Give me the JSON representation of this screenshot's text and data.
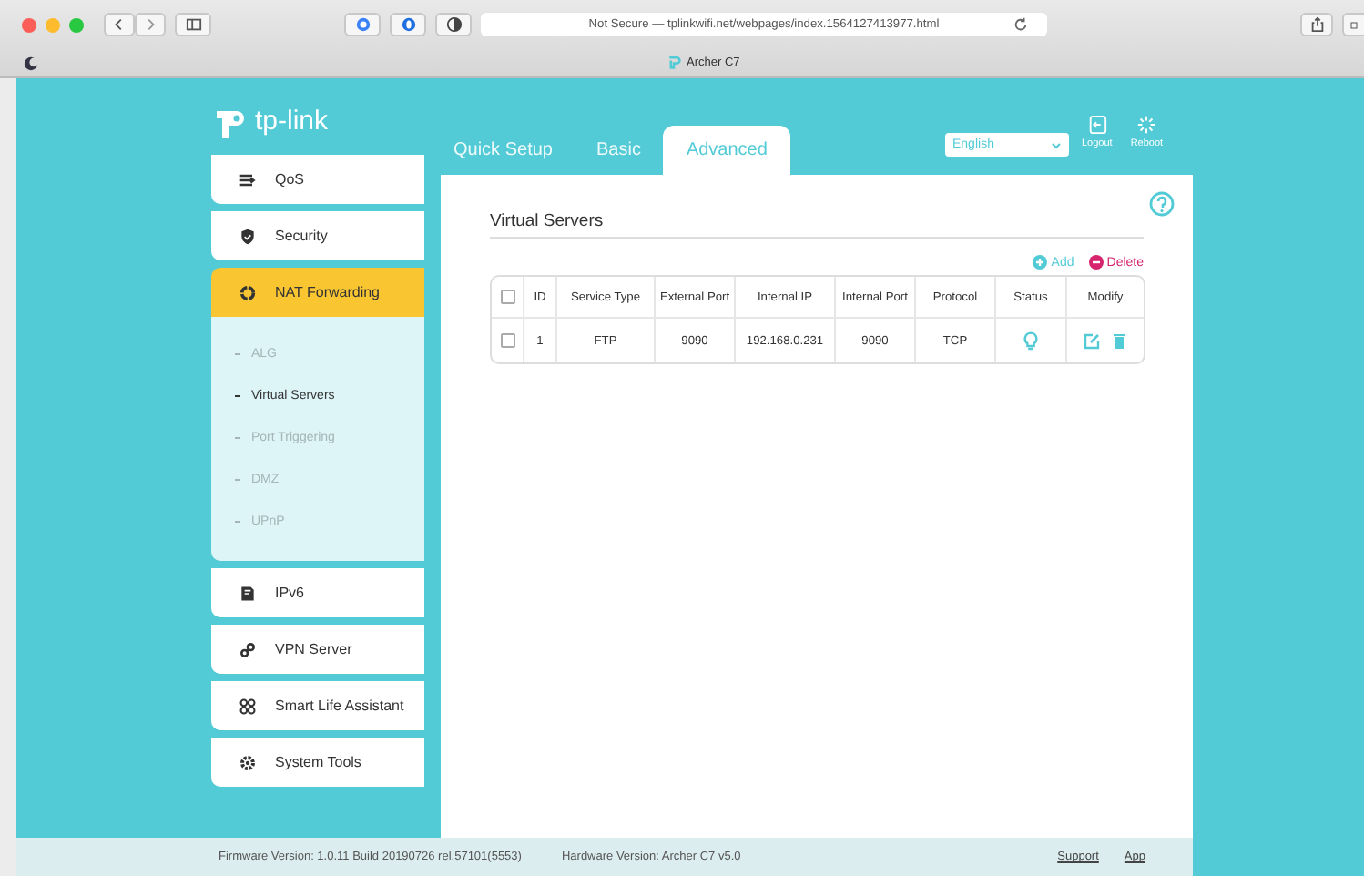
{
  "browser": {
    "address": "Not Secure — tplinkwifi.net/webpages/index.1564127413977.html",
    "tab_title": "Archer C7"
  },
  "header": {
    "logo": "tp-link",
    "tabs": [
      {
        "label": "Quick Setup",
        "selected": false
      },
      {
        "label": "Basic",
        "selected": false
      },
      {
        "label": "Advanced",
        "selected": true
      }
    ],
    "language": "English",
    "actions": [
      {
        "label": "Logout"
      },
      {
        "label": "Reboot"
      }
    ]
  },
  "sidebar": {
    "items": [
      {
        "label": "QoS",
        "selected": false
      },
      {
        "label": "Security",
        "selected": false
      },
      {
        "label": "NAT Forwarding",
        "selected": true,
        "expanded": true,
        "children": [
          {
            "label": "ALG",
            "selected": false
          },
          {
            "label": "Virtual Servers",
            "selected": true
          },
          {
            "label": "Port Triggering",
            "selected": false
          },
          {
            "label": "DMZ",
            "selected": false
          },
          {
            "label": "UPnP",
            "selected": false
          }
        ]
      },
      {
        "label": "IPv6",
        "selected": false
      },
      {
        "label": "VPN Server",
        "selected": false
      },
      {
        "label": "Smart Life Assistant",
        "selected": false
      },
      {
        "label": "System Tools",
        "selected": false
      }
    ]
  },
  "content": {
    "title": "Virtual Servers",
    "actions": [
      {
        "label": "Add",
        "kind": "add"
      },
      {
        "label": "Delete",
        "kind": "delete"
      }
    ],
    "table": {
      "all_checked": false,
      "columns": [
        "ID",
        "Service Type",
        "External Port",
        "Internal IP",
        "Internal Port",
        "Protocol",
        "Status",
        "Modify"
      ],
      "rows": [
        {
          "checked": false,
          "cells": [
            "1",
            "FTP",
            "9090",
            "192.168.0.231",
            "9090",
            "TCP"
          ],
          "enabled": true
        }
      ]
    }
  },
  "footer": {
    "firmware": "Firmware Version: 1.0.11 Build 20190726 rel.57101(5553)",
    "hardware": "Hardware Version: Archer C7 v5.0",
    "links": [
      "Support",
      "App"
    ]
  }
}
